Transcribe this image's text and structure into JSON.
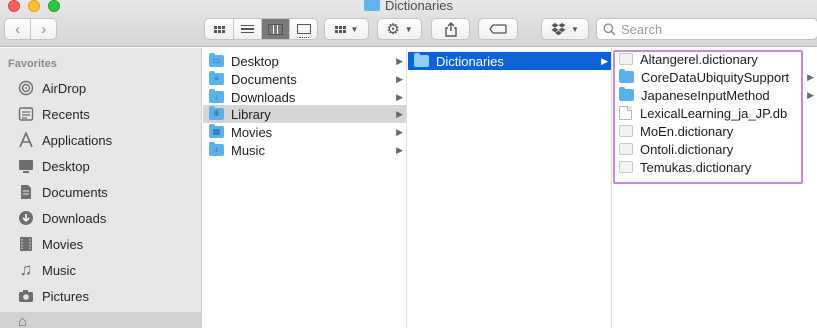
{
  "window": {
    "title": "Dictionaries"
  },
  "toolbar": {
    "back_icon": "chevron-left-icon",
    "forward_icon": "chevron-right-icon",
    "search_placeholder": "Search"
  },
  "sidebar": {
    "section": "Favorites",
    "items": [
      {
        "label": "AirDrop",
        "icon": "airdrop-icon"
      },
      {
        "label": "Recents",
        "icon": "clock-icon"
      },
      {
        "label": "Applications",
        "icon": "applications-icon"
      },
      {
        "label": "Desktop",
        "icon": "desktop-icon"
      },
      {
        "label": "Documents",
        "icon": "document-icon"
      },
      {
        "label": "Downloads",
        "icon": "download-icon"
      },
      {
        "label": "Movies",
        "icon": "film-icon"
      },
      {
        "label": "Music",
        "icon": "music-note-icon"
      },
      {
        "label": "Pictures",
        "icon": "camera-icon"
      }
    ]
  },
  "columns": {
    "col1": [
      {
        "label": "Desktop"
      },
      {
        "label": "Documents"
      },
      {
        "label": "Downloads"
      },
      {
        "label": "Library"
      },
      {
        "label": "Movies"
      },
      {
        "label": "Music"
      }
    ],
    "col2": [
      {
        "label": "Dictionaries"
      }
    ],
    "col3": [
      {
        "label": "Altangerel.dictionary"
      },
      {
        "label": "CoreDataUbiquitySupport"
      },
      {
        "label": "JapaneseInputMethod"
      },
      {
        "label": "LexicalLearning_ja_JP.db"
      },
      {
        "label": "MoEn.dictionary"
      },
      {
        "label": "Ontoli.dictionary"
      },
      {
        "label": "Temukas.dictionary"
      }
    ]
  },
  "colors": {
    "selection_blue": "#0b63d8",
    "highlight_outline": "#c58ad9",
    "folder_blue": "#5db1ea"
  }
}
